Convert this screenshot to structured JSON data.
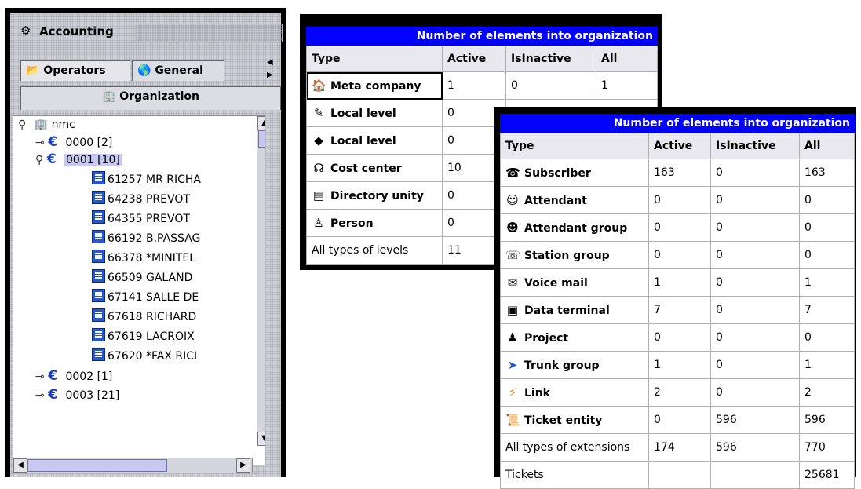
{
  "left_panel": {
    "title": "Accounting",
    "tabs": {
      "operators": "Operators",
      "general": "General",
      "organization": "Organization"
    },
    "tree": {
      "root": "nmc",
      "nodes": [
        {
          "label": "0000  [2]",
          "expanded": false
        },
        {
          "label": "0001  [10]",
          "expanded": true,
          "selected": true,
          "children": [
            "61257  MR RICHA",
            "64238  PREVOT",
            "64355  PREVOT",
            "66192  B.PASSAG",
            "66378  *MINITEL",
            "66509  GALAND",
            "67141  SALLE DE",
            "67618  RICHARD",
            "67619  LACROIX",
            "67620  *FAX RICI"
          ]
        },
        {
          "label": "0002  [1]",
          "expanded": false
        },
        {
          "label": "0003  [21]",
          "expanded": false
        }
      ]
    }
  },
  "table_levels": {
    "title": "Number of elements into organization",
    "columns": [
      "Type",
      "Active",
      "IsInactive",
      "All"
    ],
    "rows": [
      {
        "icon": "meta-company-icon",
        "type": "Meta company",
        "active": "1",
        "inactive": "0",
        "all": "1"
      },
      {
        "icon": "local-level-icon",
        "type": "Local level",
        "active": "0",
        "inactive": "",
        "all": ""
      },
      {
        "icon": "local-level-alt-icon",
        "type": "Local level",
        "active": "0",
        "inactive": "",
        "all": ""
      },
      {
        "icon": "cost-center-icon",
        "type": "Cost center",
        "active": "10",
        "inactive": "",
        "all": ""
      },
      {
        "icon": "directory-unity-icon",
        "type": "Directory unity",
        "active": "0",
        "inactive": "",
        "all": ""
      },
      {
        "icon": "person-icon",
        "type": "Person",
        "active": "0",
        "inactive": "",
        "all": ""
      }
    ],
    "total": {
      "type": "All types of levels",
      "active": "11",
      "inactive": "",
      "all": ""
    }
  },
  "table_extensions": {
    "title": "Number of elements into organization",
    "columns": [
      "Type",
      "Active",
      "IsInactive",
      "All"
    ],
    "rows": [
      {
        "icon": "subscriber-icon",
        "type": "Subscriber",
        "active": "163",
        "inactive": "0",
        "all": "163"
      },
      {
        "icon": "attendant-icon",
        "type": "Attendant",
        "active": "0",
        "inactive": "0",
        "all": "0"
      },
      {
        "icon": "attendant-group-icon",
        "type": "Attendant group",
        "active": "0",
        "inactive": "0",
        "all": "0"
      },
      {
        "icon": "station-group-icon",
        "type": "Station group",
        "active": "0",
        "inactive": "0",
        "all": "0"
      },
      {
        "icon": "voice-mail-icon",
        "type": "Voice mail",
        "active": "1",
        "inactive": "0",
        "all": "1"
      },
      {
        "icon": "data-terminal-icon",
        "type": "Data terminal",
        "active": "7",
        "inactive": "0",
        "all": "7"
      },
      {
        "icon": "project-icon",
        "type": "Project",
        "active": "0",
        "inactive": "0",
        "all": "0"
      },
      {
        "icon": "trunk-group-icon",
        "type": "Trunk group",
        "active": "1",
        "inactive": "0",
        "all": "1"
      },
      {
        "icon": "link-icon",
        "type": "Link",
        "active": "2",
        "inactive": "0",
        "all": "2"
      },
      {
        "icon": "ticket-entity-icon",
        "type": "Ticket entity",
        "active": "0",
        "inactive": "596",
        "all": "596"
      }
    ],
    "total": {
      "type": "All types of extensions",
      "active": "174",
      "inactive": "596",
      "all": "770"
    },
    "tickets": {
      "type": "Tickets",
      "active": "",
      "inactive": "",
      "all": "25681"
    }
  },
  "colors": {
    "title_bar": "#0000ff",
    "panel_bg": "#cfcfd6",
    "selected": "#c8c8f0"
  }
}
